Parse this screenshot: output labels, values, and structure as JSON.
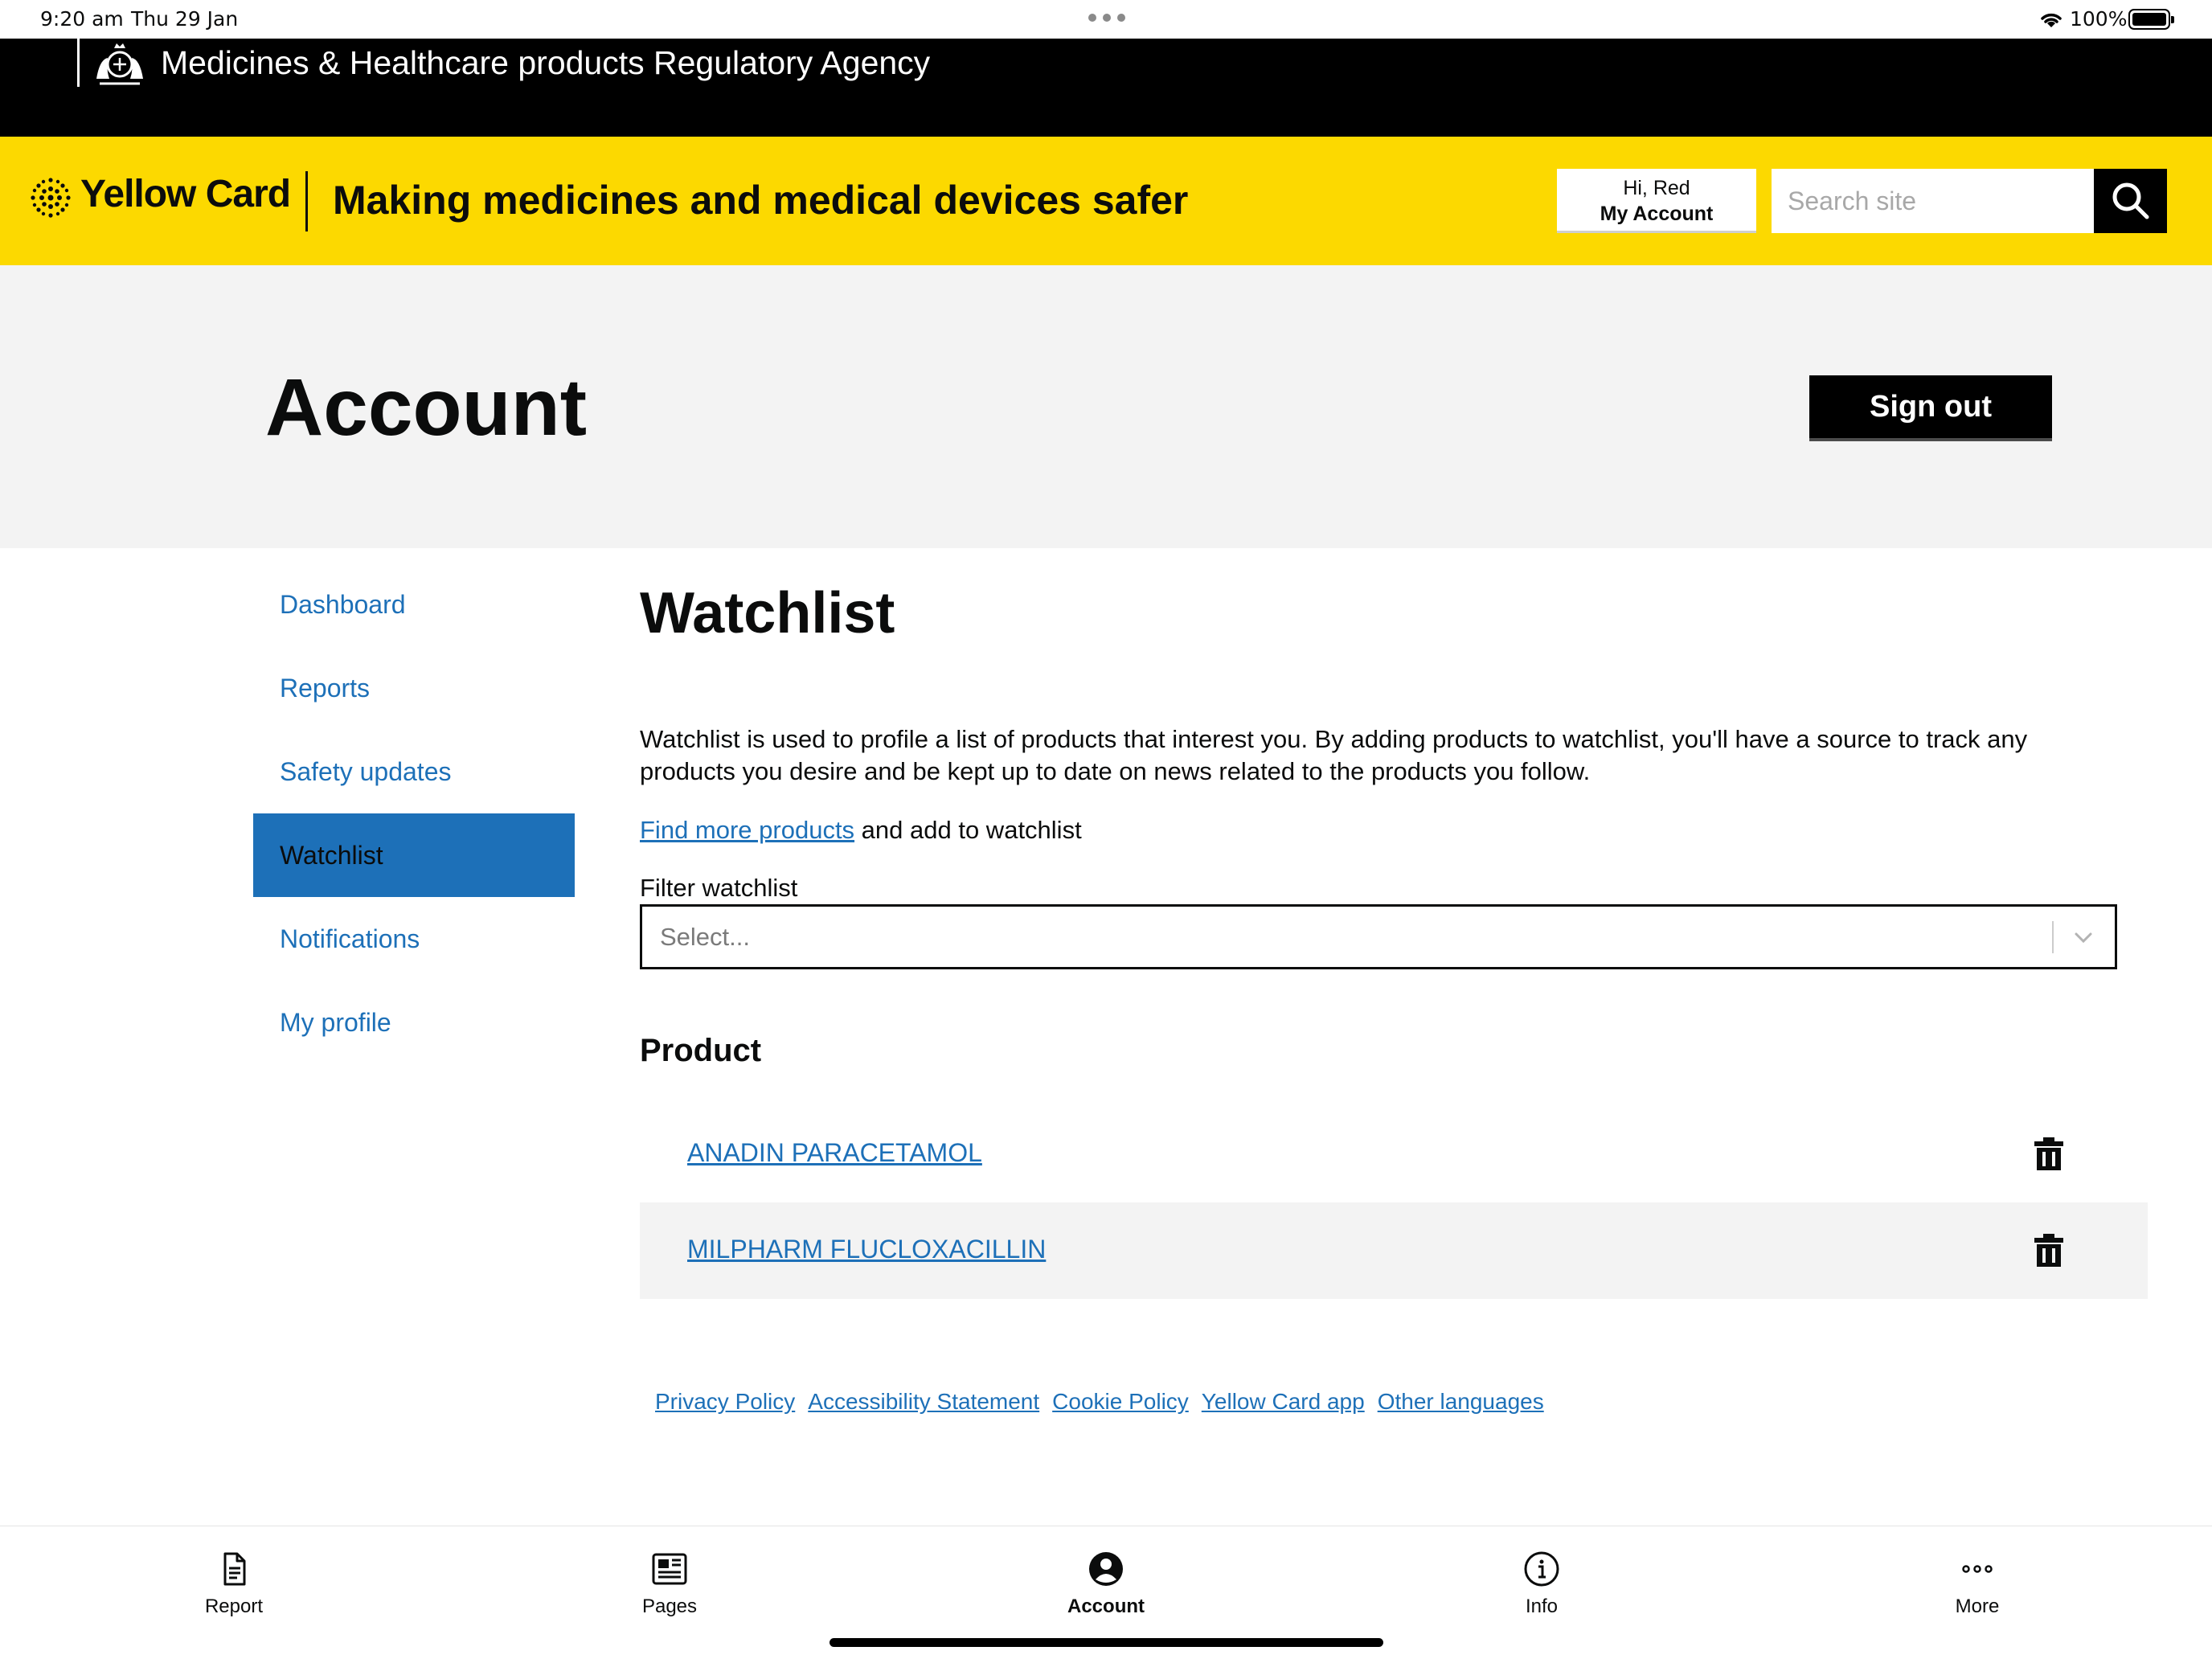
{
  "status_bar": {
    "time": "9:20 am",
    "date": "Thu 29 Jan",
    "battery": "100%"
  },
  "agency": {
    "name": "Medicines & Healthcare products Regulatory Agency"
  },
  "header": {
    "logo_text": "Yellow Card",
    "tagline": "Making medicines and medical devices safer",
    "account_greeting": "Hi, Red",
    "account_label": "My Account",
    "search_placeholder": "Search site"
  },
  "page": {
    "title": "Account",
    "sign_out_label": "Sign out"
  },
  "sidebar": {
    "items": [
      {
        "label": "Dashboard",
        "active": false
      },
      {
        "label": "Reports",
        "active": false
      },
      {
        "label": "Safety updates",
        "active": false
      },
      {
        "label": "Watchlist",
        "active": true
      },
      {
        "label": "Notifications",
        "active": false
      },
      {
        "label": "My profile",
        "active": false
      }
    ]
  },
  "watchlist": {
    "heading": "Watchlist",
    "intro": "Watchlist is used to profile a list of products that interest you. By adding products to watchlist, you'll have a source to track any products you desire and be kept up to date on news related to the products you follow.",
    "find_link": "Find more products",
    "find_suffix": " and add to watchlist",
    "filter_label": "Filter watchlist",
    "filter_placeholder": "Select...",
    "product_heading": "Product",
    "products": [
      {
        "name": "ANADIN PARACETAMOL"
      },
      {
        "name": "MILPHARM FLUCLOXACILLIN"
      }
    ]
  },
  "footer": {
    "links": [
      "Privacy Policy",
      "Accessibility Statement",
      "Cookie Policy",
      "Yellow Card app",
      "Other languages"
    ]
  },
  "tabbar": {
    "tabs": [
      {
        "label": "Report",
        "icon": "document-icon",
        "active": false
      },
      {
        "label": "Pages",
        "icon": "newspaper-icon",
        "active": false
      },
      {
        "label": "Account",
        "icon": "person-circle-icon",
        "active": true
      },
      {
        "label": "Info",
        "icon": "info-icon",
        "active": false
      },
      {
        "label": "More",
        "icon": "ellipsis-icon",
        "active": false
      }
    ]
  },
  "colors": {
    "brand_yellow": "#fcd900",
    "link_blue": "#1d70b8",
    "black": "#000000"
  }
}
